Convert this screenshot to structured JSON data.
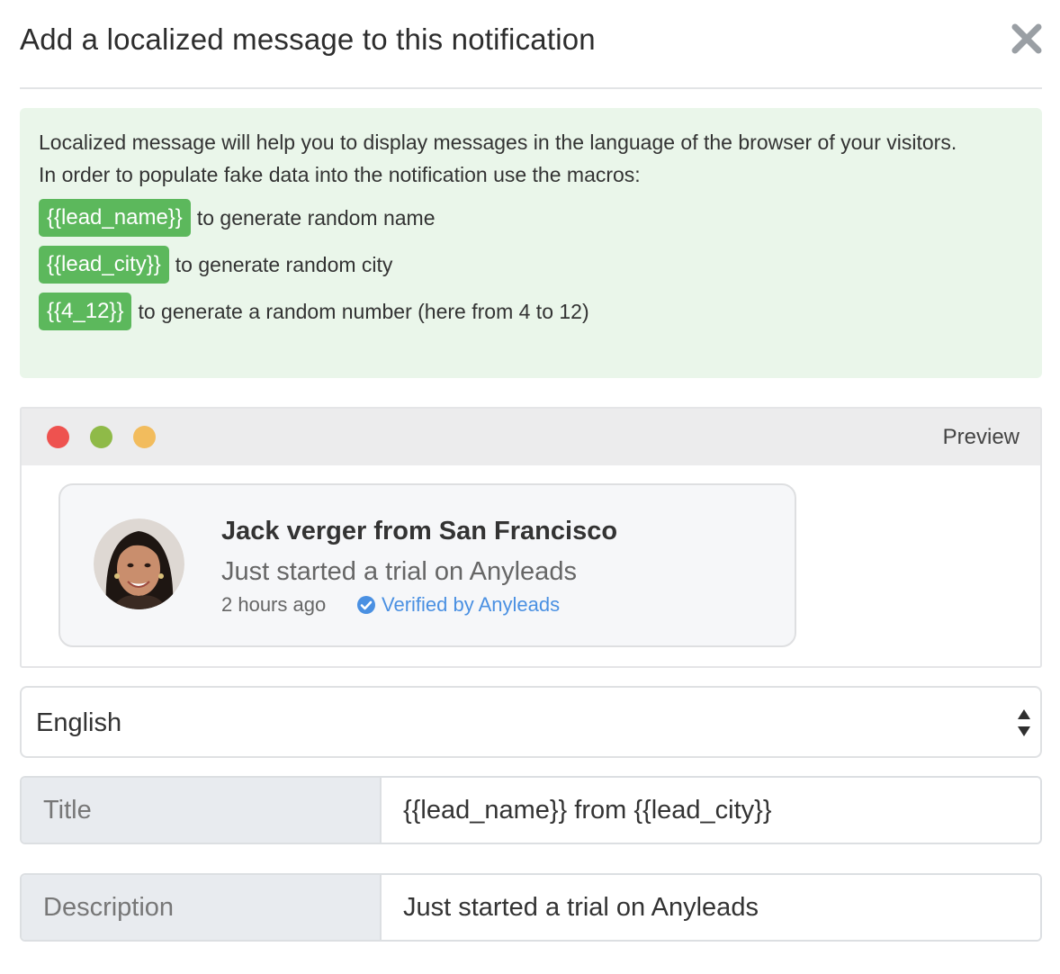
{
  "modal": {
    "title": "Add a localized message to this notification",
    "close_icon": "close-icon"
  },
  "info": {
    "line1": "Localized message will help you to display messages in the language of the browser of your visitors.",
    "line2": "In order to populate fake data into the notification use the macros:",
    "macros": [
      {
        "badge": "{{lead_name}}",
        "text": "to generate random name"
      },
      {
        "badge": "{{lead_city}}",
        "text": "to generate random city"
      },
      {
        "badge": "{{4_12}}",
        "text": "to generate a random number (here from 4 to 12)"
      }
    ],
    "badge_color": "#5cb85c",
    "background_color": "#eaf6ea"
  },
  "preview": {
    "label": "Preview",
    "window_dots": [
      "#ee524f",
      "#8fba48",
      "#f2bc5d"
    ],
    "notification": {
      "avatar": "avatar-photo",
      "title": "Jack verger from San Francisco",
      "description": "Just started a trial on Anyleads",
      "time": "2 hours ago",
      "verified_icon": "check-circle-icon",
      "verified_text": "Verified by Anyleads",
      "verified_color": "#4a90e2"
    }
  },
  "language_select": {
    "selected": "English",
    "arrows_icon": "sort-arrows-icon"
  },
  "fields": {
    "title_label": "Title",
    "title_value": "{{lead_name}} from {{lead_city}}",
    "description_label": "Description",
    "description_value": "Just started a trial on Anyleads"
  }
}
